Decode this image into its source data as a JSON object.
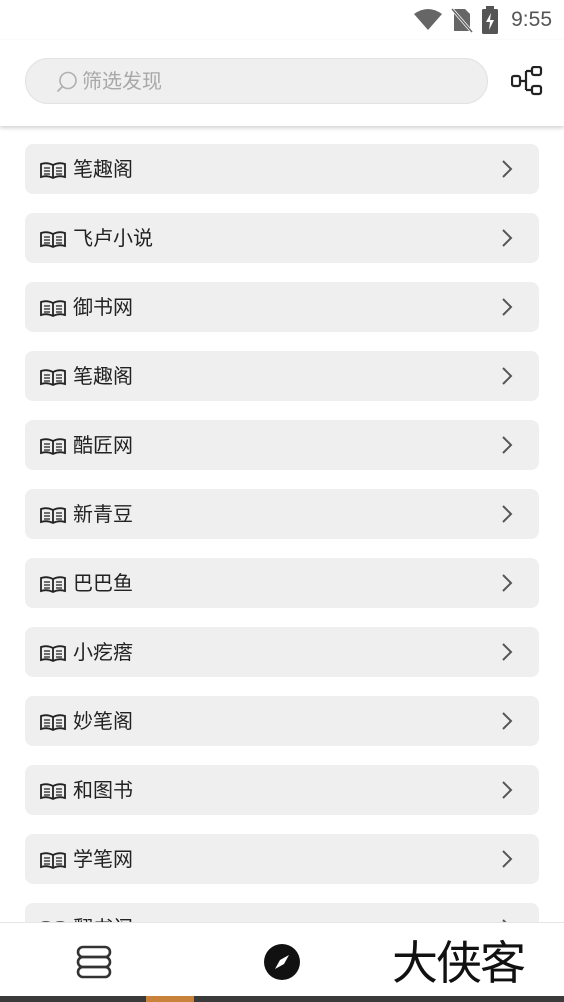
{
  "status_bar": {
    "time": "9:55",
    "icons": [
      "wifi-icon",
      "no-sim-icon",
      "battery-charging-icon"
    ]
  },
  "search": {
    "placeholder": "筛选发现",
    "value": ""
  },
  "header": {
    "action_icon": "tree-structure-icon"
  },
  "list": {
    "items": [
      {
        "label": "笔趣阁",
        "icon": "book-icon"
      },
      {
        "label": "飞卢小说",
        "icon": "book-icon"
      },
      {
        "label": "御书网",
        "icon": "book-icon"
      },
      {
        "label": "笔趣阁",
        "icon": "book-icon"
      },
      {
        "label": "酷匠网",
        "icon": "book-icon"
      },
      {
        "label": "新青豆",
        "icon": "book-icon"
      },
      {
        "label": "巴巴鱼",
        "icon": "book-icon"
      },
      {
        "label": "小疙瘩",
        "icon": "book-icon"
      },
      {
        "label": "妙笔阁",
        "icon": "book-icon"
      },
      {
        "label": "和图书",
        "icon": "book-icon"
      },
      {
        "label": "学笔网",
        "icon": "book-icon"
      },
      {
        "label": "翻书阁",
        "icon": "book-icon"
      }
    ]
  },
  "bottom_nav": {
    "items": [
      {
        "icon": "bookshelf-icon",
        "active": false
      },
      {
        "icon": "compass-icon",
        "active": true
      }
    ],
    "watermark": "大侠客"
  },
  "colors": {
    "item_background": "#efefef",
    "search_background": "#efefef",
    "icon_dark": "#222222",
    "accent": "#c8823a"
  }
}
